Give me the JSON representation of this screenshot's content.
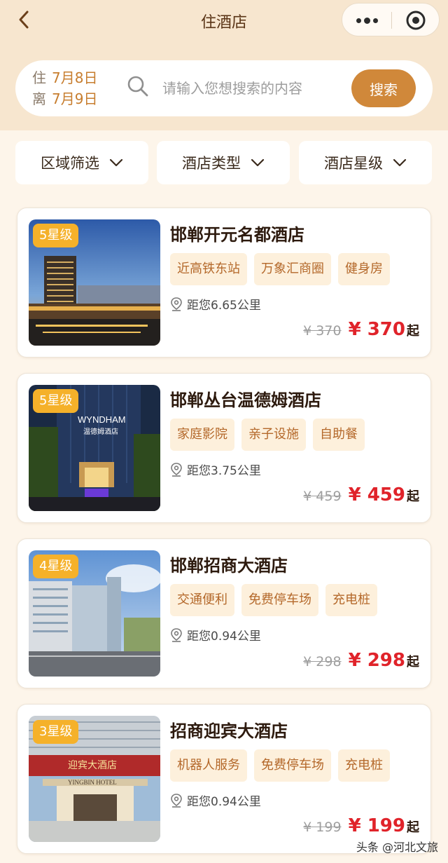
{
  "nav": {
    "title": "住酒店"
  },
  "search": {
    "checkin_label": "住",
    "checkin_date": "7月8日",
    "checkout_label": "离",
    "checkout_date": "7月9日",
    "placeholder": "请输入您想搜索的内容",
    "button": "搜索"
  },
  "filters": [
    "区域筛选",
    "酒店类型",
    "酒店星级"
  ],
  "hotels": [
    {
      "star": "5星级",
      "name": "邯郸开元名都酒店",
      "tags": [
        "近高铁东站",
        "万象汇商圈",
        "健身房"
      ],
      "distance": "距您6.65公里",
      "old_price": "¥ 370",
      "price": "¥ 370",
      "unit": "起"
    },
    {
      "star": "5星级",
      "name": "邯郸丛台温德姆酒店",
      "tags": [
        "家庭影院",
        "亲子设施",
        "自助餐"
      ],
      "distance": "距您3.75公里",
      "old_price": "¥ 459",
      "price": "¥ 459",
      "unit": "起",
      "sign_text": "WYNDHAM",
      "sign_sub": "温德姆酒店"
    },
    {
      "star": "4星级",
      "name": "邯郸招商大酒店",
      "tags": [
        "交通便利",
        "免费停车场",
        "充电桩"
      ],
      "distance": "距您0.94公里",
      "old_price": "¥ 298",
      "price": "¥ 298",
      "unit": "起"
    },
    {
      "star": "3星级",
      "name": "招商迎宾大酒店",
      "tags": [
        "机器人服务",
        "免费停车场",
        "充电桩"
      ],
      "distance": "距您0.94公里",
      "old_price": "¥ 199",
      "price": "¥ 199",
      "unit": "起",
      "sign_text": "迎宾大酒店",
      "sign_sub": "YINGBIN HOTEL"
    }
  ],
  "watermark": "头条 @河北文旅",
  "colors": {
    "accent": "#d0883a",
    "price": "#e0232a",
    "badge": "#f5b12a",
    "tag_bg": "#fdf0dc",
    "tag_text": "#b4682a"
  }
}
